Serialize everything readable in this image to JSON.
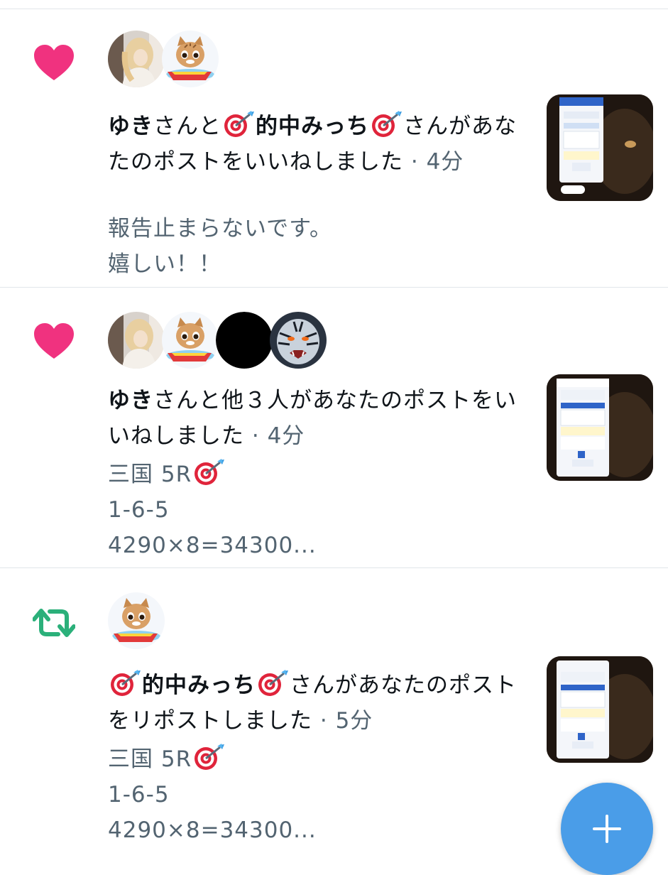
{
  "notifications": [
    {
      "type": "like",
      "icon": "heart-icon",
      "icon_color": "#f91880",
      "actor_name": "ゆき",
      "mid1": "さんと",
      "actor2_name": "的中みっち",
      "rest": "さんがあなたのポストをいいねしました",
      "sep": " · ",
      "time": "4分",
      "body": [
        "報告止まらないです。",
        "嬉しい！！"
      ]
    },
    {
      "type": "like",
      "icon": "heart-icon",
      "icon_color": "#f91880",
      "actor_name": "ゆき",
      "rest": "さんと他３人があなたのポストをいいねしました",
      "sep": " · ",
      "time": "4分",
      "body": [
        "三国 5R",
        "1-6-5",
        "4290×8=34300..."
      ]
    },
    {
      "type": "repost",
      "icon": "repost-icon",
      "icon_color": "#00ba7c",
      "actor_name": "的中みっち",
      "rest": "さんがあなたのポストをリポストしました",
      "sep": " · ",
      "time": "5分",
      "body": [
        "三国 5R",
        "1-6-5",
        "4290×8=34300..."
      ]
    }
  ],
  "fab": {
    "icon": "plus-icon",
    "color": "#4a9de8"
  },
  "colors": {
    "divider": "#e1e6ea",
    "secondary_text": "#536471"
  }
}
